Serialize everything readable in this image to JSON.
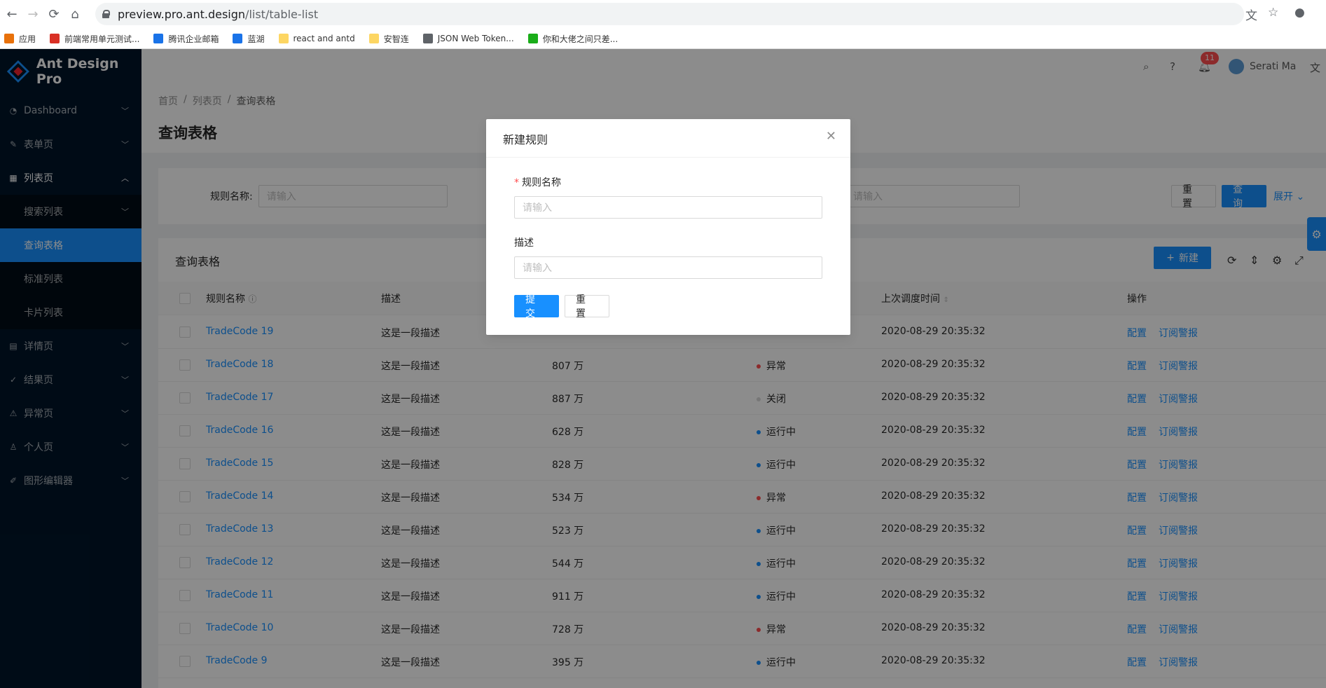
{
  "browser": {
    "url_host": "preview.pro.ant.design",
    "url_path": "/list/table-list",
    "bookmarks": [
      {
        "label": "应用",
        "color": "#e8710a"
      },
      {
        "label": "前端常用单元测试...",
        "color": "#d93025"
      },
      {
        "label": "腾讯企业邮箱",
        "color": "#1a73e8"
      },
      {
        "label": "蓝湖",
        "color": "#1a73e8"
      },
      {
        "label": "react and antd",
        "color": "#fdd663"
      },
      {
        "label": "安智连",
        "color": "#fdd663"
      },
      {
        "label": "JSON Web Token...",
        "color": "#5f6368"
      },
      {
        "label": "你和大佬之间只差...",
        "color": "#1aad19"
      }
    ]
  },
  "app": {
    "title": "Ant Design Pro",
    "user": "Serati Ma",
    "notification_count": "11"
  },
  "sidebar": {
    "items": [
      {
        "label": "Dashboard",
        "icon": "dashboard-icon"
      },
      {
        "label": "表单页",
        "icon": "form-icon"
      },
      {
        "label": "列表页",
        "icon": "table-icon",
        "open": true
      },
      {
        "label": "详情页",
        "icon": "profile-icon"
      },
      {
        "label": "结果页",
        "icon": "check-circle-icon"
      },
      {
        "label": "异常页",
        "icon": "warning-icon"
      },
      {
        "label": "个人页",
        "icon": "user-icon"
      },
      {
        "label": "图形编辑器",
        "icon": "highlight-icon"
      }
    ],
    "sub_items": [
      {
        "label": "搜索列表",
        "has_arrow": true
      },
      {
        "label": "查询表格",
        "active": true
      },
      {
        "label": "标准列表"
      },
      {
        "label": "卡片列表"
      }
    ]
  },
  "breadcrumb": [
    "首页",
    "列表页",
    "查询表格"
  ],
  "page_title": "查询表格",
  "search": {
    "rule_name_label": "规则名称:",
    "placeholder": "请输入",
    "placeholder_right": "请输入",
    "reset": "重 置",
    "query": "查 询",
    "expand": "展开"
  },
  "table": {
    "title": "查询表格",
    "new_button": "新建",
    "columns": {
      "name": "规则名称",
      "desc": "描述",
      "last_time": "上次调度时间",
      "actions": "操作"
    },
    "rows": [
      {
        "name": "TradeCode 19",
        "desc": "这是一段描述",
        "calls": "",
        "status": "",
        "status_color": "",
        "time": "2020-08-29 20:35:32"
      },
      {
        "name": "TradeCode 18",
        "desc": "这是一段描述",
        "calls": "807 万",
        "status": "异常",
        "status_color": "#ff4d4f",
        "time": "2020-08-29 20:35:32"
      },
      {
        "name": "TradeCode 17",
        "desc": "这是一段描述",
        "calls": "887 万",
        "status": "关闭",
        "status_color": "#d9d9d9",
        "time": "2020-08-29 20:35:32"
      },
      {
        "name": "TradeCode 16",
        "desc": "这是一段描述",
        "calls": "628 万",
        "status": "运行中",
        "status_color": "#1890ff",
        "time": "2020-08-29 20:35:32"
      },
      {
        "name": "TradeCode 15",
        "desc": "这是一段描述",
        "calls": "828 万",
        "status": "运行中",
        "status_color": "#1890ff",
        "time": "2020-08-29 20:35:32"
      },
      {
        "name": "TradeCode 14",
        "desc": "这是一段描述",
        "calls": "534 万",
        "status": "异常",
        "status_color": "#ff4d4f",
        "time": "2020-08-29 20:35:32"
      },
      {
        "name": "TradeCode 13",
        "desc": "这是一段描述",
        "calls": "523 万",
        "status": "运行中",
        "status_color": "#1890ff",
        "time": "2020-08-29 20:35:32"
      },
      {
        "name": "TradeCode 12",
        "desc": "这是一段描述",
        "calls": "544 万",
        "status": "运行中",
        "status_color": "#1890ff",
        "time": "2020-08-29 20:35:32"
      },
      {
        "name": "TradeCode 11",
        "desc": "这是一段描述",
        "calls": "911 万",
        "status": "运行中",
        "status_color": "#1890ff",
        "time": "2020-08-29 20:35:32"
      },
      {
        "name": "TradeCode 10",
        "desc": "这是一段描述",
        "calls": "728 万",
        "status": "异常",
        "status_color": "#ff4d4f",
        "time": "2020-08-29 20:35:32"
      },
      {
        "name": "TradeCode 9",
        "desc": "这是一段描述",
        "calls": "395 万",
        "status": "运行中",
        "status_color": "#1890ff",
        "time": "2020-08-29 20:35:32"
      }
    ],
    "action_config": "配置",
    "action_subscribe": "订阅警报"
  },
  "modal": {
    "title": "新建规则",
    "name_label": "规则名称",
    "name_placeholder": "请输入",
    "desc_label": "描述",
    "desc_placeholder": "请输入",
    "submit": "提 交",
    "reset": "重 置"
  },
  "colors": {
    "primary": "#1890ff",
    "sider": "#001529",
    "danger": "#ff4d4f"
  }
}
